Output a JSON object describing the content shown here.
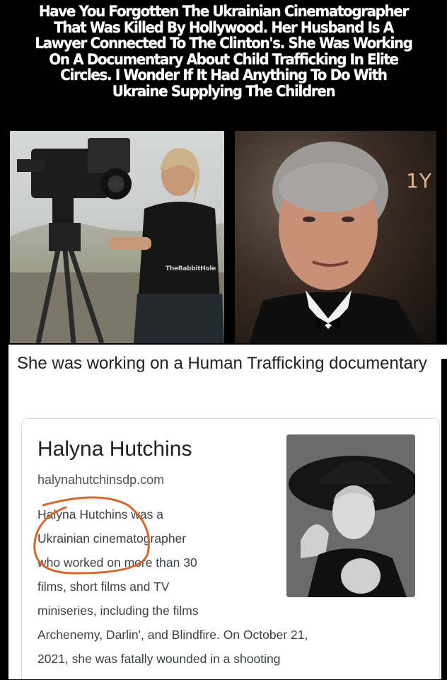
{
  "headline": {
    "lines": [
      "Have You Forgotten The Ukrainian Cinematographer",
      "That Was Killed By Hollywood. Her Husband Is A",
      "Lawyer Connected To The Clinton's. She Was Working",
      "On A Documentary About Child Trafficking In Elite",
      "Circles. I Wonder If It Had Anything To Do With",
      "Ukraine Supplying The Children"
    ]
  },
  "photos": {
    "watermark": "TheRabbitHole",
    "corner_text": "1Y"
  },
  "card": {
    "intro": "She was working on a Human Trafficking documentary",
    "title": "Halyna Hutchins",
    "url": "halynahutchinsdp.com",
    "description_lines": [
      "Halyna Hutchins was a",
      "Ukrainian cinematographer",
      "who worked on more than 30",
      "films, short films and TV",
      "miniseries, including the films",
      "Archenemy, Darlin', and Blindfire. On October 21,",
      "2021, she was fatally wounded in a shooting"
    ]
  },
  "colors": {
    "background": "#000000",
    "headline_text": "#ffffff",
    "card_bg": "#ffffff",
    "title_text": "#202124",
    "body_text": "#3c4043",
    "annotation": "#d9662a"
  }
}
